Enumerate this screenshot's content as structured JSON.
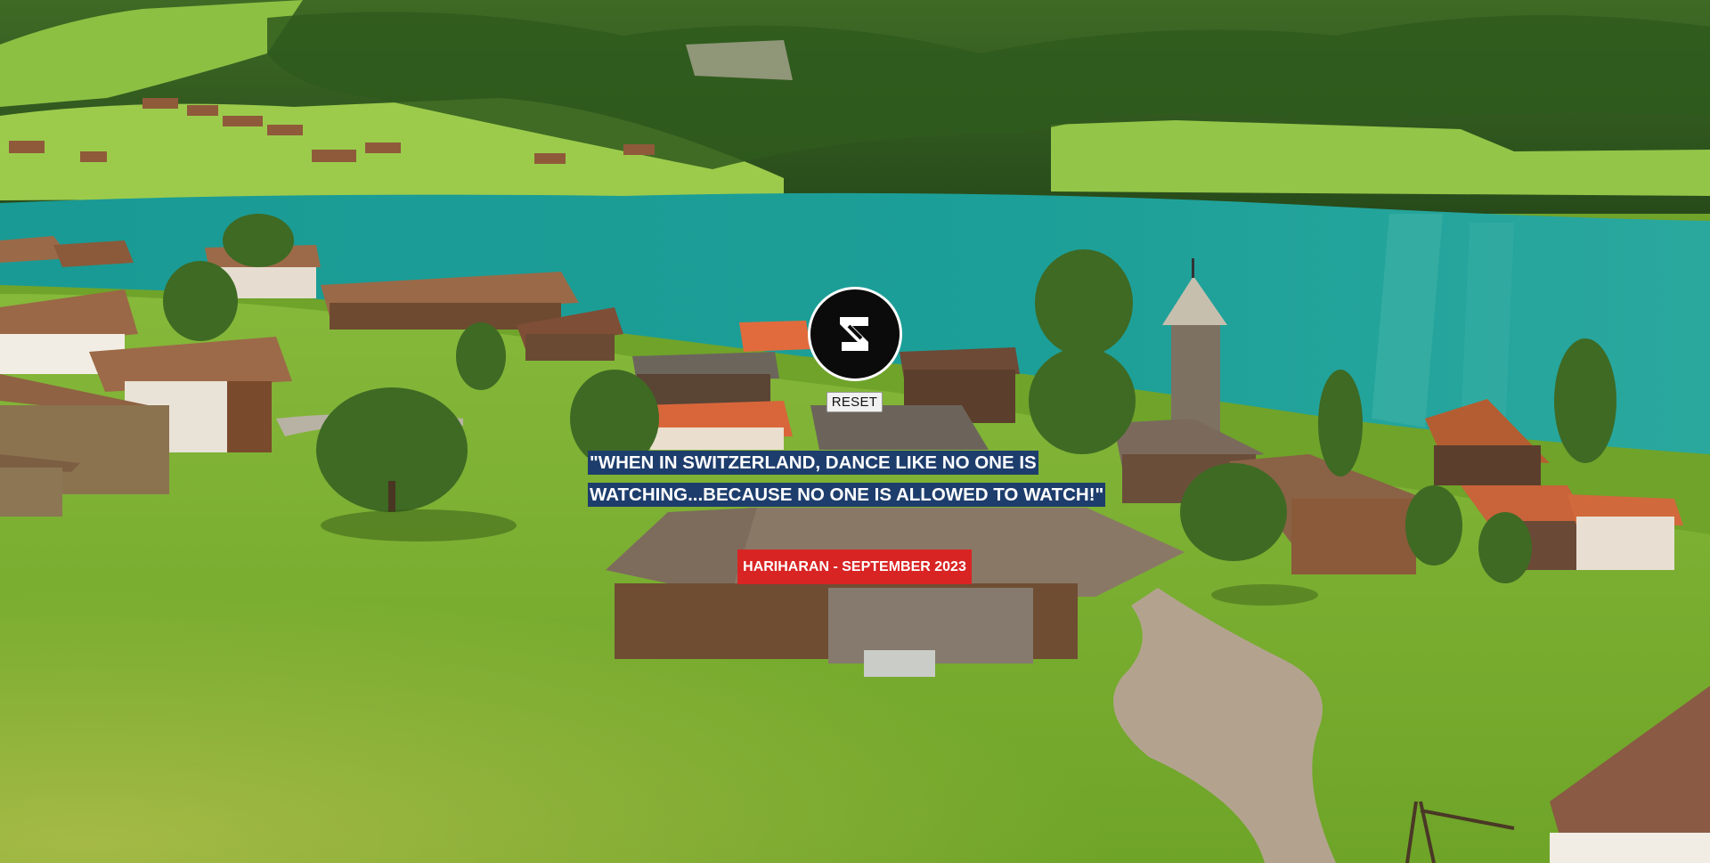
{
  "background": {
    "description_icon": "alpine-lake-village-photo-icon",
    "colors": {
      "lake": "#1f9c95",
      "meadow": "#6fa32a",
      "forest": "#2d4d1c",
      "roof_brown": "#8a5a3b",
      "roof_orange": "#d8663a"
    }
  },
  "logo": {
    "icon": "s-monogram-logo-icon",
    "color": "#0b0b0b"
  },
  "reset": {
    "label": "RESET"
  },
  "quote": {
    "line1": "\"WHEN IN SWITZERLAND, DANCE LIKE NO ONE IS",
    "line2": "WATCHING...BECAUSE NO ONE IS ALLOWED TO WATCH!\"",
    "highlight_color": "#1d3d6c"
  },
  "credit": {
    "label": "HARIHARAN - SEPTEMBER 2023",
    "color": "#d92424"
  }
}
